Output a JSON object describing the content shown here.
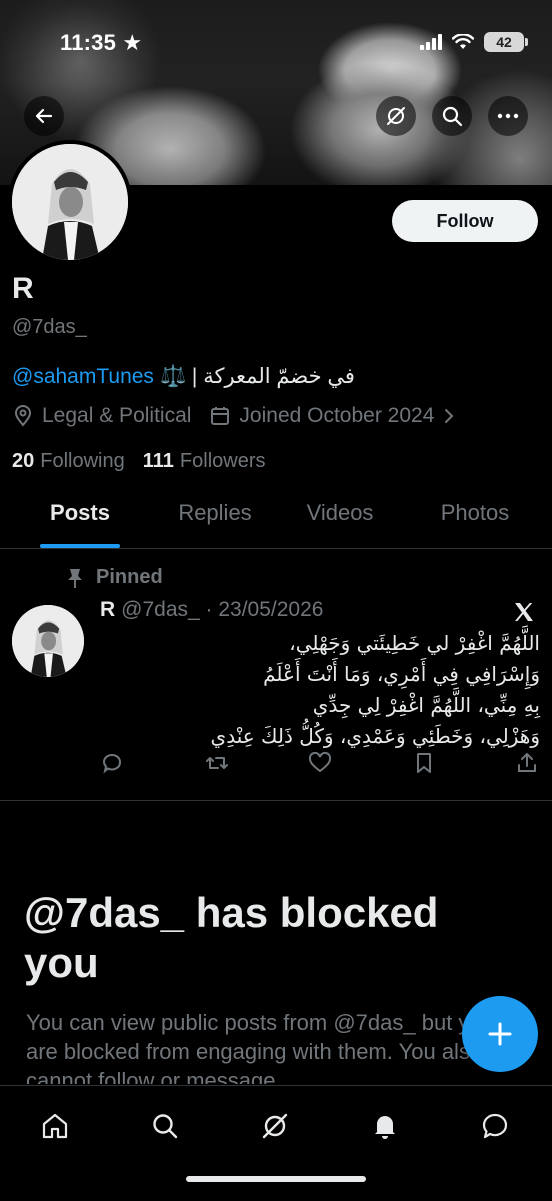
{
  "status_bar": {
    "time": "11:35",
    "battery": "42"
  },
  "profile": {
    "display_name": "R",
    "handle": "@7das_",
    "bio_mention": "@sahamTunes",
    "bio_text": "في خضمّ المعركة | ⚖️",
    "category": "Legal & Political",
    "joined": "Joined October 2024",
    "following_count": "20",
    "following_label": "Following",
    "followers_count": "111",
    "followers_label": "Followers",
    "follow_label": "Follow"
  },
  "tabs": [
    {
      "label": "Posts",
      "active": true
    },
    {
      "label": "Replies",
      "active": false
    },
    {
      "label": "Videos",
      "active": false
    },
    {
      "label": "Photos",
      "active": false
    }
  ],
  "pinned_post": {
    "pinned_label": "Pinned",
    "author": "R",
    "handle_date": "@7das_ · 23/05/2026",
    "text": "اللَّهُمَّ اغْفِرْ لي خَطِيئَتي وَجَهْلِي،\nوَإِسْرَافِي فِي أَمْرِي، وَمَا أَنْتَ أَعْلَمُ\nبِهِ مِنِّي، اللَّهُمَّ اغْفِرْ لِي جِدِّي\nوَهَزْلِي، وَخَطَئِي وَعَمْدِي، وَكُلُّ ذَلِكَ عِنْدِي"
  },
  "blocked": {
    "title": "@7das_ has blocked you",
    "body": "You can view public posts from @7das_ but you are blocked from engaging with them. You also cannot follow or message"
  },
  "colors": {
    "accent": "#1d9bf0",
    "background": "#000000",
    "muted": "#71767b",
    "text": "#e7e9ea"
  }
}
